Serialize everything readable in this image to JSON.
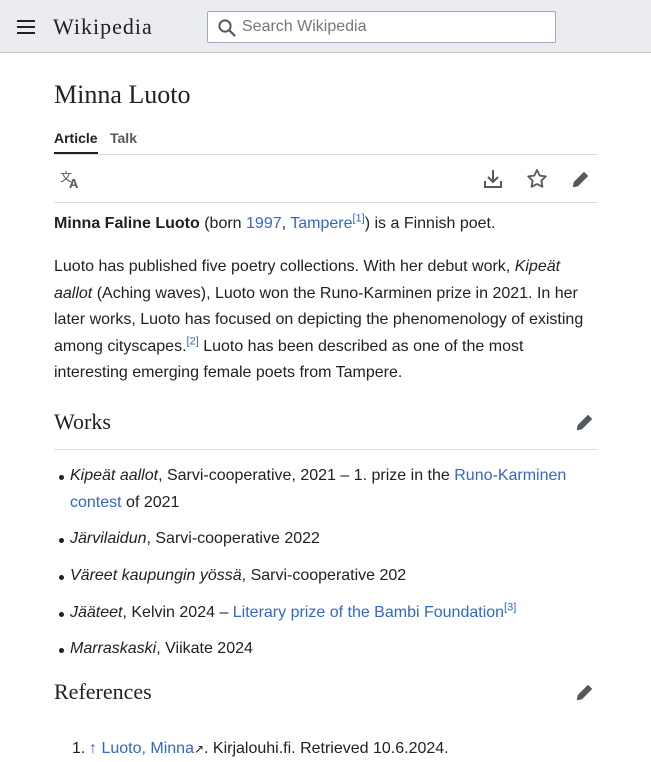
{
  "header": {
    "wordmark": "Wikipedia",
    "search_placeholder": "Search Wikipedia"
  },
  "page": {
    "title": "Minna Luoto",
    "tabs": [
      {
        "label": "Article",
        "active": true
      },
      {
        "label": "Talk",
        "active": false
      }
    ]
  },
  "intro": {
    "name": "Minna Faline Luoto",
    "born_prefix": " (born ",
    "year": "1997",
    "comma": ", ",
    "place": "Tampere",
    "ref1": "[1]",
    "suffix": ") is a Finnish poet."
  },
  "para2": {
    "t1": "Luoto has published five poetry collections. With her debut work, ",
    "debut": "Kipeät aallot",
    "t2": "  (Aching waves), Luoto won the Runo-Karminen prize in 2021. In her later works, Luoto has focused on depicting the phenomenology of existing among cityscapes.",
    "ref2": "[2]",
    "t3": " Luoto has been described as one of the most interesting emerging female poets from Tampere."
  },
  "works": {
    "heading": "Works",
    "items": [
      {
        "title": "Kipeät aallot",
        "text": ", Sarvi-cooperative, 2021 – 1. prize in the ",
        "link": "Runo-Karminen contest",
        "after": " of 2021"
      },
      {
        "title": "Järvilaidun",
        "text": ", Sarvi-cooperative 2022"
      },
      {
        "title": "Väreet kaupungin yössä",
        "text": ", Sarvi-cooperative 202"
      },
      {
        "title": "Jääteet",
        "text": ", Kelvin 2024 – ",
        "link": "Literary prize of the Bambi Foundation",
        "ref": "[3]"
      },
      {
        "title": "Marraskaski",
        "text": ", Viikate 2024"
      }
    ]
  },
  "references": {
    "heading": "References",
    "items": [
      {
        "num": "1.",
        "caret": "↑",
        "link": "Luoto, Minna",
        "text": ". Kirjalouhi.fi. Retrieved 10.6.2024."
      }
    ]
  },
  "colors": {
    "link": "#3366cc",
    "header_bg": "#eaecf0",
    "text": "#202122"
  }
}
